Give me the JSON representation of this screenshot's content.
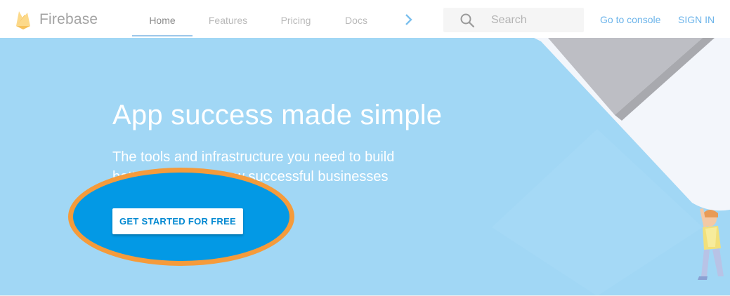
{
  "brand": {
    "name": "Firebase",
    "logo_icon": "firebase-flame-icon",
    "colors": {
      "flame_light": "#fcd98a",
      "flame_dark": "#f8c662"
    }
  },
  "nav": {
    "tabs": [
      {
        "label": "Home",
        "active": true
      },
      {
        "label": "Features",
        "active": false
      },
      {
        "label": "Pricing",
        "active": false
      },
      {
        "label": "Docs",
        "active": false
      }
    ],
    "more_icon": "chevron-right-icon"
  },
  "search": {
    "placeholder": "Search",
    "icon": "search-icon"
  },
  "actions": {
    "console_label": "Go to console",
    "signin_label": "SIGN IN"
  },
  "hero": {
    "title": "App success made simple",
    "subtitle": "The tools and infrastructure you need to build better apps and grow successful businesses",
    "cta_label": "GET STARTED FOR FREE",
    "background_color": "#a1d7f5",
    "highlight_fill": "#0399e5",
    "highlight_ring": "#f59b3b",
    "illustration": "person-holding-phone-illustration"
  }
}
